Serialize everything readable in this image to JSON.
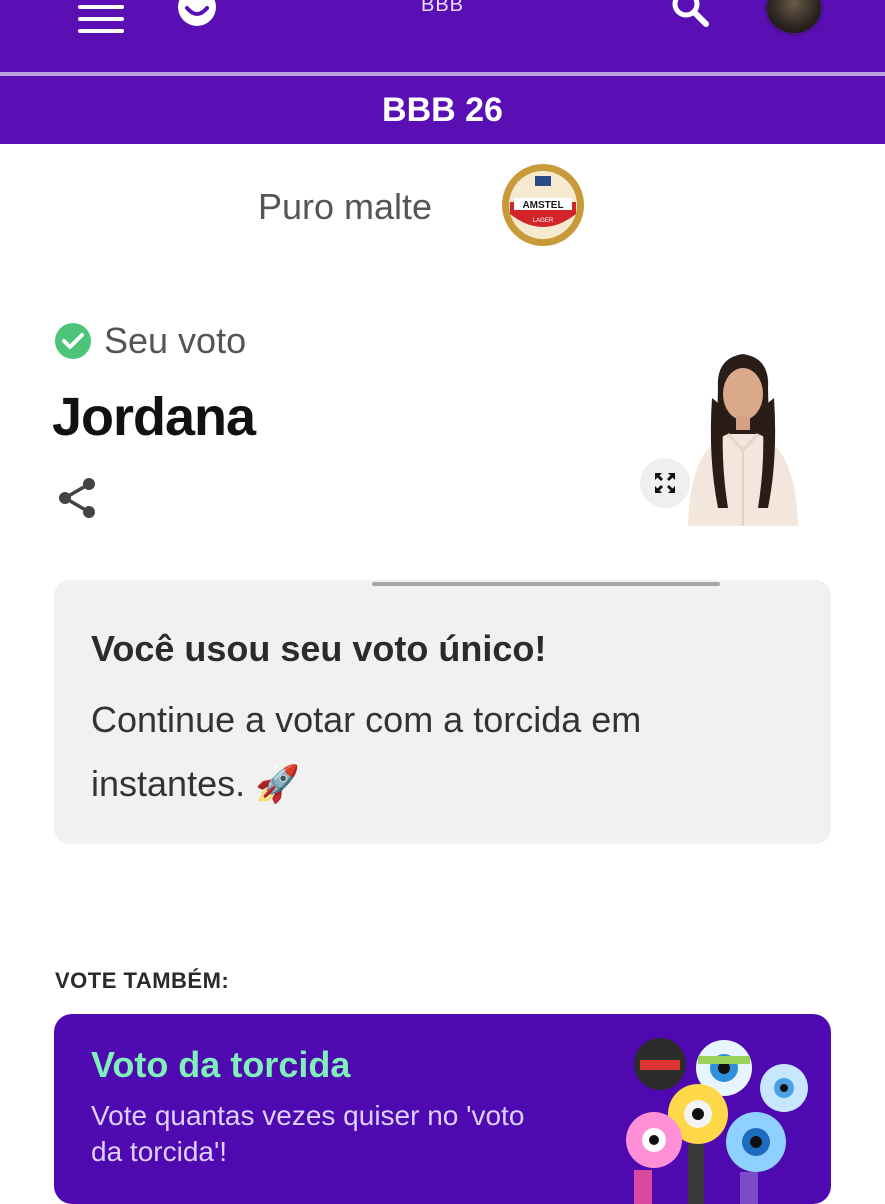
{
  "header": {
    "title": "BBB",
    "menu_icon": "hamburger-menu-icon",
    "logo_icon": "globoplay-logo-icon",
    "search_icon": "search-icon",
    "accent_color": "#5a0fb4"
  },
  "subheader": {
    "title": "BBB 26"
  },
  "sponsor": {
    "tagline": "Puro malte",
    "logo_text": "AMSTEL",
    "logo_subtext": "LAGER"
  },
  "vote": {
    "status_label": "Seu voto",
    "candidate": "Jordana",
    "check_color": "#4cc47a"
  },
  "notice": {
    "title": "Você usou seu voto único!",
    "body": "Continue a votar com a torcida em instantes. 🚀"
  },
  "also_vote": {
    "heading": "VOTE TAMBÉM:"
  },
  "promo": {
    "title": "Voto da torcida",
    "body": "Vote quantas vezes quiser no 'voto da torcida'!",
    "title_color": "#7ef0b8"
  }
}
